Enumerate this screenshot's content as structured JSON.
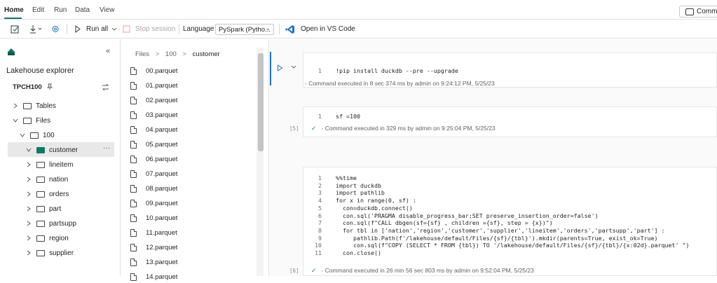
{
  "menubar": {
    "items": [
      "Home",
      "Edit",
      "Run",
      "Data",
      "View"
    ],
    "comments_label": "Comme"
  },
  "toolbar": {
    "run_all": "Run all",
    "stop_session": "Stop session",
    "language_label": "Language",
    "language_value": "PySpark (Pytho...",
    "open_vscode": "Open in VS Code"
  },
  "lakehouse": {
    "title": "Lakehouse explorer",
    "name": "TPCH100",
    "tree": {
      "tables": "Tables",
      "files": "Files",
      "folder_100": "100",
      "subfolders": [
        "customer",
        "lineitem",
        "nation",
        "orders",
        "part",
        "partsupp",
        "region",
        "supplier"
      ]
    }
  },
  "files": {
    "breadcrumb": [
      "Files",
      "100",
      "customer"
    ],
    "items": [
      "00.parquet",
      "01.parquet",
      "02.parquet",
      "03.parquet",
      "04.parquet",
      "05.parquet",
      "06.parquet",
      "07.parquet",
      "08.parquet",
      "09.parquet",
      "10.parquet",
      "11.parquet",
      "12.parquet",
      "13.parquet",
      "14.parquet"
    ]
  },
  "cells": [
    {
      "exec_count": "",
      "lines": [
        "!pip install duckdb --pre --upgrade"
      ],
      "status": "- Command executed in 8 sec 374 ms by admin on 9:24:12 PM, 5/25/23"
    },
    {
      "exec_count": "[5]",
      "lines": [
        "sf =100"
      ],
      "status": "- Command executed in 329 ms by admin on 9:25:04 PM, 5/25/23"
    },
    {
      "exec_count": "[6]",
      "lines": [
        "%%time",
        "import duckdb",
        "import pathlib",
        "for x in range(0, sf) :",
        "  con=duckdb.connect()",
        "  con.sql('PRAGMA disable_progress_bar;SET preserve_insertion_order=false')",
        "  con.sql(f\"CALL dbgen(sf={sf} , children ={sf}, step = {x})\")",
        "  for tbl in ['nation','region','customer','supplier','lineitem','orders','partsupp','part'] :",
        "     pathlib.Path(f'/lakehouse/default/Files/{sf}/{tbl}').mkdir(parents=True, exist_ok=True)",
        "     con.sql(f\"COPY (SELECT * FROM {tbl}) TO '/lakehouse/default/Files/{sf}/{tbl}/{x:02d}.parquet' \")",
        "  con.close()"
      ],
      "status": "- Command executed in 26 min 56 sec 803 ms by admin on 9:52:04 PM, 5/25/23"
    }
  ]
}
